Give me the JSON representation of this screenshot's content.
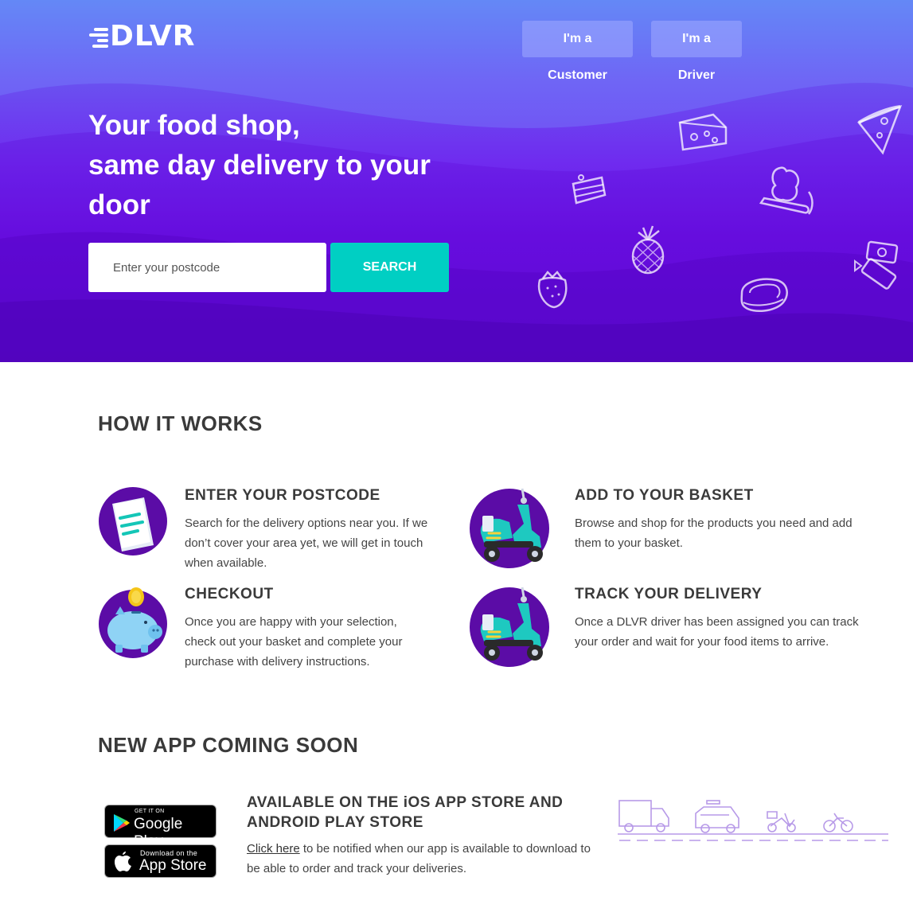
{
  "header": {
    "logo": "DLVR",
    "nav": [
      {
        "label": "I'm a Customer"
      },
      {
        "label": "I'm a Driver"
      }
    ]
  },
  "hero": {
    "title_line1": "Your food shop,",
    "title_line2": "same day delivery to your",
    "title_line3": "door",
    "postcode_placeholder": "Enter your postcode",
    "search_label": "SEARCH"
  },
  "how_it_works": {
    "title": "HOW IT WORKS",
    "steps": [
      {
        "heading": "ENTER YOUR POSTCODE",
        "text": "Search for the delivery options near you. If we don’t cover your area yet, we will get in touch when available.",
        "icon": "document-icon"
      },
      {
        "heading": "ADD TO YOUR BASKET",
        "text": "Browse and shop for the products you need and add them to your basket.",
        "icon": "scooter-icon"
      },
      {
        "heading": "CHECKOUT",
        "text": "Once you are happy with your selection, check out your basket and complete your purchase with delivery instructions.",
        "icon": "piggy-bank-icon"
      },
      {
        "heading": "TRACK YOUR DELIVERY",
        "text": "Once a DLVR driver has been assigned you can track your order and wait for your food items to arrive.",
        "icon": "scooter-icon"
      }
    ]
  },
  "app": {
    "title": "NEW APP COMING SOON",
    "google_small": "GET IT ON",
    "google_big": "Google Play",
    "apple_small": "Download on the",
    "apple_big": "App Store",
    "heading": "AVAILABLE ON THE iOS APP STORE AND ANDROID PLAY STORE",
    "link_text": "Click here",
    "text_after_link": " to be notified when our app is available to download to be able to order and track your deliveries."
  },
  "colors": {
    "accent": "#00cfc3",
    "hero_top": "#5a86f2",
    "hero_bottom": "#5f0fd2",
    "icon_circle": "#5b0ca6"
  }
}
